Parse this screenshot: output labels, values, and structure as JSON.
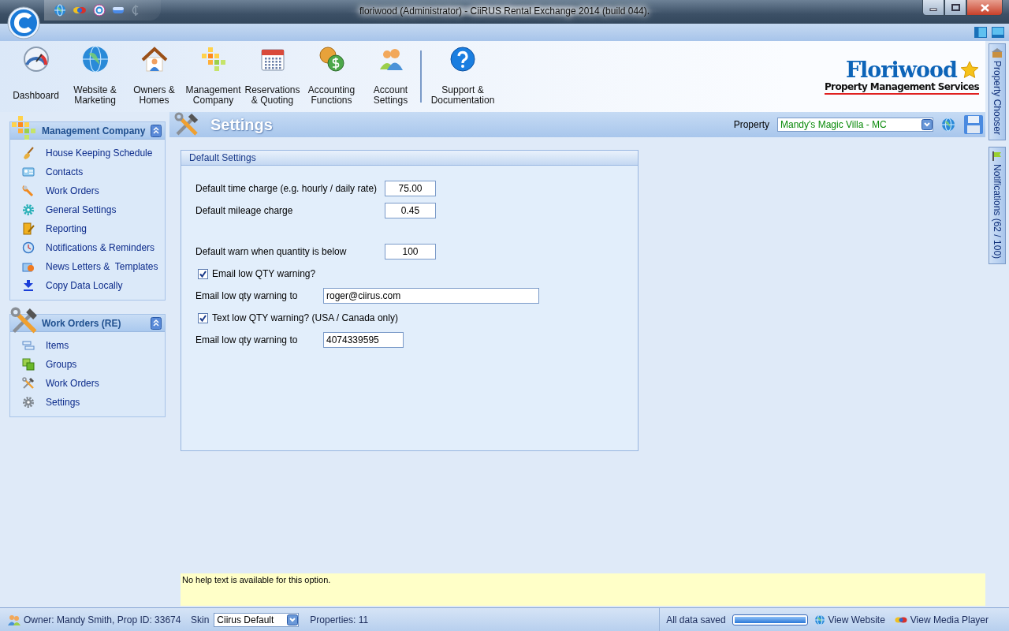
{
  "window": {
    "title": "floriwood (Administrator) - CiiRUS Rental Exchange 2014 (build 044)."
  },
  "ribbon": {
    "buttons": [
      {
        "label": "Dashboard",
        "separated": false
      },
      {
        "label": "Website &\nMarketing",
        "separated": false
      },
      {
        "label": "Owners &\nHomes",
        "separated": false
      },
      {
        "label": "Management\nCompany",
        "separated": false
      },
      {
        "label": "Reservations\n& Quoting",
        "separated": false
      },
      {
        "label": "Accounting\nFunctions",
        "separated": false
      },
      {
        "label": "Account\nSettings",
        "separated": false
      },
      {
        "label": "Support &\nDocumentation",
        "separated": true
      }
    ],
    "logo": {
      "name": "Floriwood",
      "tagline": "Property Management Services"
    }
  },
  "side_tabs": [
    {
      "label": "Property Chooser"
    },
    {
      "label": "Notifications (62 / 100)"
    }
  ],
  "sidebar": {
    "panels": [
      {
        "title": "Management Company",
        "expanded": true,
        "items": [
          {
            "label": "House Keeping Schedule"
          },
          {
            "label": "Contacts"
          },
          {
            "label": "Work Orders"
          },
          {
            "label": "General Settings"
          },
          {
            "label": "Reporting"
          },
          {
            "label": "Notifications & Reminders"
          },
          {
            "label": "News Letters &  Templates"
          },
          {
            "label": "Copy Data Locally"
          }
        ]
      },
      {
        "title": "Work Orders (RE)",
        "expanded": true,
        "items": [
          {
            "label": "Items"
          },
          {
            "label": "Groups"
          },
          {
            "label": "Work Orders"
          },
          {
            "label": "Settings"
          }
        ]
      }
    ]
  },
  "page_header": {
    "title": "Settings",
    "property_label": "Property",
    "property_value": "Mandy's Magic Villa - MC"
  },
  "settings": {
    "title": "Default Settings",
    "groups": [
      {
        "rows": [
          {
            "kind": "number",
            "label": "Default time charge (e.g. hourly / daily rate)",
            "value": "75.00"
          },
          {
            "kind": "number",
            "label": "Default mileage charge",
            "value": "0.45"
          }
        ]
      },
      {
        "rows": [
          {
            "kind": "number",
            "label": "Default warn when quantity is below",
            "value": "100"
          },
          {
            "kind": "checkbox",
            "label": "Email low QTY warning?",
            "checked": true
          },
          {
            "kind": "email",
            "label": "Email low qty warning to",
            "value": "roger@ciirus.com"
          },
          {
            "kind": "checkbox",
            "label": "Text low QTY warning? (USA / Canada only)",
            "checked": true
          },
          {
            "kind": "phone",
            "label": "Email low qty warning to",
            "value": "4074339595"
          }
        ]
      }
    ]
  },
  "help": {
    "text": "No help text is available for this option."
  },
  "status_bar": {
    "owner": "Owner: Mandy Smith, Prop ID: 33674",
    "skin_label": "Skin",
    "skin_value": "Ciirus Default",
    "properties": "Properties: 11",
    "save_status": "All data saved",
    "save_progress": {
      "level": 1
    },
    "links": [
      {
        "label": "View Website"
      },
      {
        "label": "View Media Player"
      }
    ]
  }
}
